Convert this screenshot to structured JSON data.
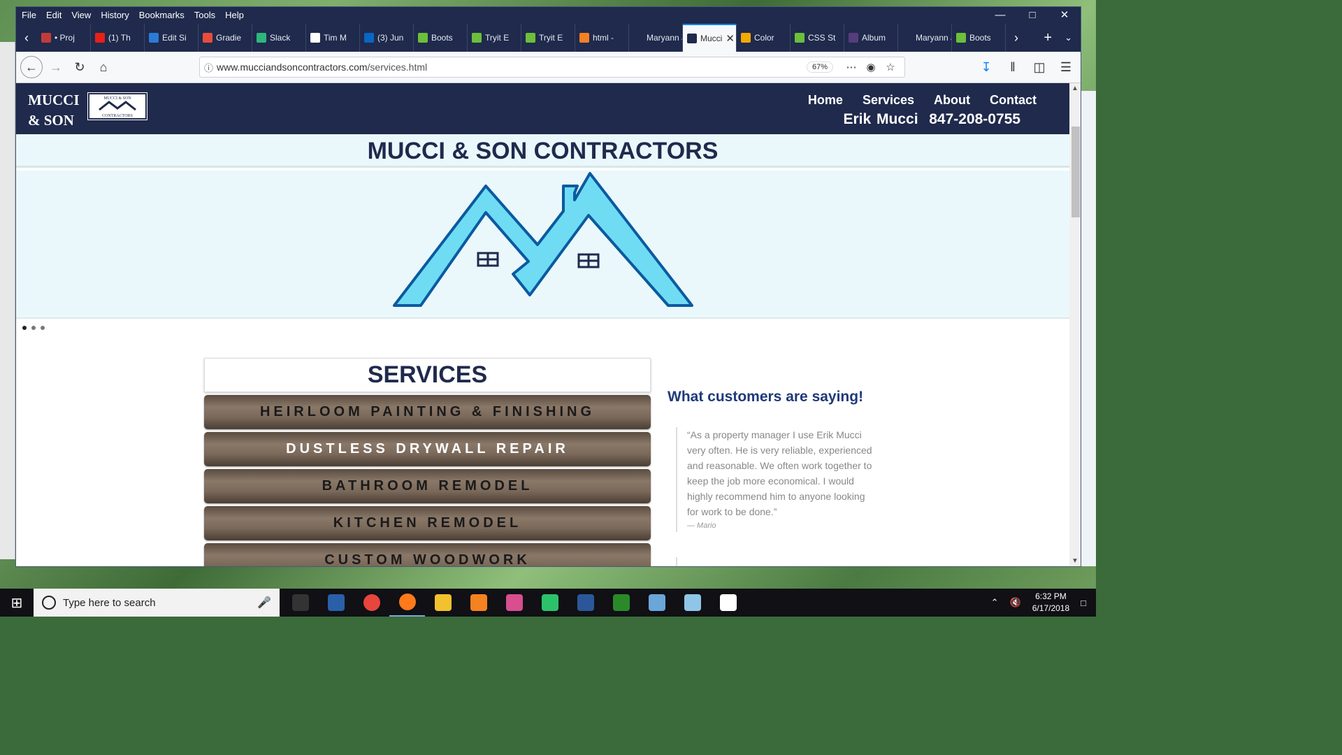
{
  "browser": {
    "menu": [
      "File",
      "Edit",
      "View",
      "History",
      "Bookmarks",
      "Tools",
      "Help"
    ],
    "tabs": [
      {
        "label": "• Proj",
        "color": "#c23b3b"
      },
      {
        "label": "(1) Th",
        "color": "#e62117"
      },
      {
        "label": "Edit Si",
        "color": "#2b7bd6"
      },
      {
        "label": "Gradie",
        "color": "#e84c3d"
      },
      {
        "label": "Slack",
        "color": "#2eb67d"
      },
      {
        "label": "Tim M",
        "color": "#ffffff"
      },
      {
        "label": "(3) Jun",
        "color": "#0a66c2"
      },
      {
        "label": "Boots",
        "color": "#6cbf3b"
      },
      {
        "label": "Tryit E",
        "color": "#6cbf3b"
      },
      {
        "label": "Tryit E",
        "color": "#6cbf3b"
      },
      {
        "label": "html -",
        "color": "#f48024"
      },
      {
        "label": "Maryann J",
        "color": "#1f2a4c"
      },
      {
        "label": "Mucci",
        "color": "#1f2a4c",
        "active": true
      },
      {
        "label": "Color",
        "color": "#f2a900"
      },
      {
        "label": "CSS St",
        "color": "#6cbf3b"
      },
      {
        "label": "Album",
        "color": "#563d7c"
      },
      {
        "label": "Maryann J",
        "color": "#1f2a4c"
      },
      {
        "label": "Boots",
        "color": "#6cbf3b"
      }
    ],
    "url_host": "www.mucciandsoncontractors.com",
    "url_path": "/services.html",
    "zoom": "67%"
  },
  "site": {
    "logo_line1": "MUCCI",
    "logo_line2": "& SON",
    "logo_box_line1": "MUCCI & SON",
    "logo_box_line2": "CONTRACTORS",
    "nav": {
      "home": "Home",
      "services": "Services",
      "about": "About",
      "contact": "Contact"
    },
    "contact_line": "Erik Mucci  847-208-0755",
    "headline": "MUCCI & SON CONTRACTORS",
    "hero_colors": {
      "fill": "#6fdcf4",
      "stroke": "#0b5aa0"
    },
    "services_title": "SERVICES",
    "services": [
      {
        "label": "HEIRLOOM PAINTING & FINISHING",
        "tone": "dark"
      },
      {
        "label": "DUSTLESS DRYWALL REPAIR",
        "tone": "light"
      },
      {
        "label": "BATHROOM REMODEL",
        "tone": "dark"
      },
      {
        "label": "KITCHEN REMODEL",
        "tone": "dark"
      },
      {
        "label": "CUSTOM WOODWORK",
        "tone": "dark"
      }
    ],
    "testimonials_title": "What customers are saying!",
    "testimonial": "“As a property manager I use Erik Mucci very often. He is very reliable, experienced and reasonable. We often work together to keep the job more economical. I would highly recommend him to anyone looking for work to be done.”",
    "testimonial_author": "— Mario"
  },
  "taskbar": {
    "search_placeholder": "Type here to search",
    "time": "6:32 PM",
    "date": "6/17/2018",
    "apps": [
      {
        "name": "task-view",
        "color": "#333"
      },
      {
        "name": "remote-desktop",
        "color": "#2b5fa8"
      },
      {
        "name": "chrome",
        "color": "#e8453c"
      },
      {
        "name": "firefox",
        "color": "#ff7a1a"
      },
      {
        "name": "file-explorer",
        "color": "#f2c12e"
      },
      {
        "name": "sublime-text",
        "color": "#f58220"
      },
      {
        "name": "paint",
        "color": "#d84e8f"
      },
      {
        "name": "git-kraken",
        "color": "#2cc26a"
      },
      {
        "name": "word",
        "color": "#2b579a"
      },
      {
        "name": "dreamweaver",
        "color": "#2a8a2a"
      },
      {
        "name": "paint-net",
        "color": "#6aa6d8"
      },
      {
        "name": "notepad",
        "color": "#8fc6e8"
      },
      {
        "name": "photos",
        "color": "#ffffff"
      }
    ]
  }
}
